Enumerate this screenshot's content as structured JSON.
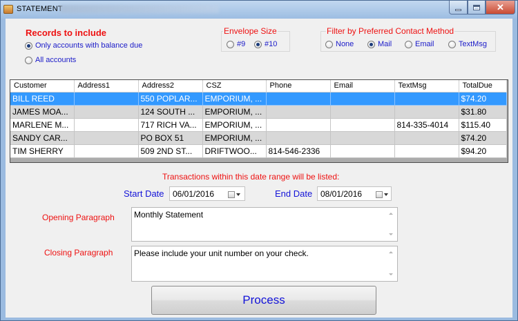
{
  "window": {
    "title": "STATEMENT",
    "controls": {
      "minimize": "minimize",
      "maximize": "maximize",
      "close": "✕"
    }
  },
  "records": {
    "heading": "Records to include",
    "options": [
      {
        "label": "Only accounts with balance due",
        "selected": true
      },
      {
        "label": "All accounts",
        "selected": false
      }
    ]
  },
  "envelope": {
    "heading": "Envelope Size",
    "options": [
      {
        "label": "#9",
        "selected": false
      },
      {
        "label": "#10",
        "selected": true
      }
    ]
  },
  "contact_filter": {
    "heading": "Filter by Preferred Contact Method",
    "options": [
      {
        "label": "None",
        "selected": false
      },
      {
        "label": "Mail",
        "selected": true
      },
      {
        "label": "Email",
        "selected": false
      },
      {
        "label": "TextMsg",
        "selected": false
      }
    ]
  },
  "grid": {
    "columns": [
      "Customer",
      "Address1",
      "Address2",
      "CSZ",
      "Phone",
      "Email",
      "TextMsg",
      "TotalDue"
    ],
    "rows": [
      [
        "BILL REED",
        "",
        "550 POPLAR...",
        "EMPORIUM, ...",
        "",
        "",
        "",
        "$74.20"
      ],
      [
        "JAMES MOA...",
        "",
        "124 SOUTH ...",
        "EMPORIUM, ...",
        "",
        "",
        "",
        "$31.80"
      ],
      [
        "MARLENE M...",
        "",
        "717 RICH VA...",
        "EMPORIUM, ...",
        "",
        "",
        "814-335-4014",
        "$115.40"
      ],
      [
        "SANDY CAR...",
        "",
        "PO BOX 51",
        "EMPORIUM, ...",
        "",
        "",
        "",
        "$74.20"
      ],
      [
        "TIM SHERRY",
        "",
        "509 2ND ST...",
        "DRIFTWOO...",
        "814-546-2336",
        "",
        "",
        "$94.20"
      ]
    ],
    "selected_row": 0
  },
  "date_range": {
    "notice": "Transactions within this date range will be listed:",
    "start_label": "Start Date",
    "start_value": "06/01/2016",
    "end_label": "End Date",
    "end_value": "08/01/2016"
  },
  "opening": {
    "label": "Opening Paragraph",
    "value": "Monthly Statement"
  },
  "closing": {
    "label": "Closing Paragraph",
    "value": "Please include your unit number on your check."
  },
  "process_button": "Process",
  "colors": {
    "accent_red": "#ee1111",
    "accent_blue": "#1212d8",
    "selection": "#3399ff"
  }
}
